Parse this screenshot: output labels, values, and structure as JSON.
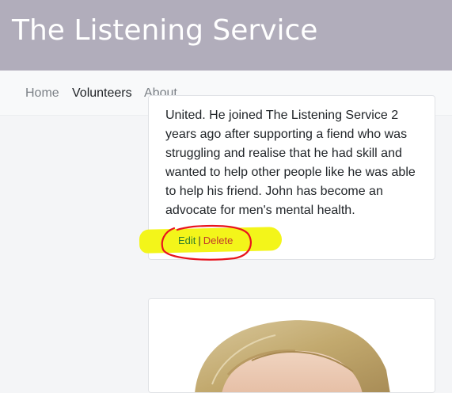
{
  "header": {
    "title": "The Listening Service"
  },
  "nav": {
    "items": [
      {
        "label": "Home"
      },
      {
        "label": "Volunteers"
      },
      {
        "label": "About"
      }
    ],
    "active": "Volunteers"
  },
  "volunteer_card": {
    "bio_lines": [
      "United. He joined The Listening Service 2",
      "years ago after supporting a fiend who was",
      "struggling and realise that he had skill and",
      "wanted to help other people like he was able",
      "to help his friend. John has become an",
      "advocate for men's mental health."
    ],
    "edit_label": "Edit",
    "separator": "|",
    "delete_label": "Delete"
  },
  "colors": {
    "header_bg": "#b1adbb",
    "highlight": "#f3f51a",
    "annotation_circle": "#e8141e"
  }
}
